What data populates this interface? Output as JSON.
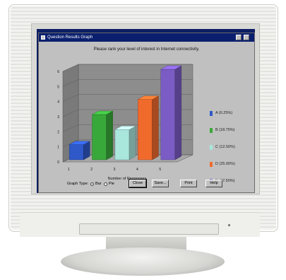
{
  "window": {
    "title": "Question Results Graph",
    "prompt": "Please rank your level of interest in Internet connectivity."
  },
  "chart_data": {
    "type": "bar",
    "categories": [
      "1",
      "2",
      "3",
      "4",
      "5"
    ],
    "values": [
      1,
      3,
      2,
      4,
      6
    ],
    "xlabel": "Number of Responses",
    "ylim": [
      0,
      6
    ],
    "yticks": [
      "0",
      "1",
      "2",
      "3",
      "4",
      "5",
      "6"
    ],
    "grid": true,
    "legend_position": "right",
    "colors": [
      "#2f59c8",
      "#39a83a",
      "#a9e6dc",
      "#f06a2c",
      "#7b5cc4"
    ],
    "legend": [
      "A (6.25%)",
      "B (18.75%)",
      "C (12.50%)",
      "D (25.00%)",
      "E (37.50%)"
    ]
  },
  "bottombar": {
    "graph_type_label": "Graph Type:",
    "bar_option": "Bar",
    "pie_option": "Pie",
    "close_button": "Close",
    "save_button": "Save...",
    "print_button": "Print",
    "help_button": "Help"
  },
  "colors": {
    "titlebar": "#0a1f6e",
    "window_face": "#c0c0c0"
  }
}
